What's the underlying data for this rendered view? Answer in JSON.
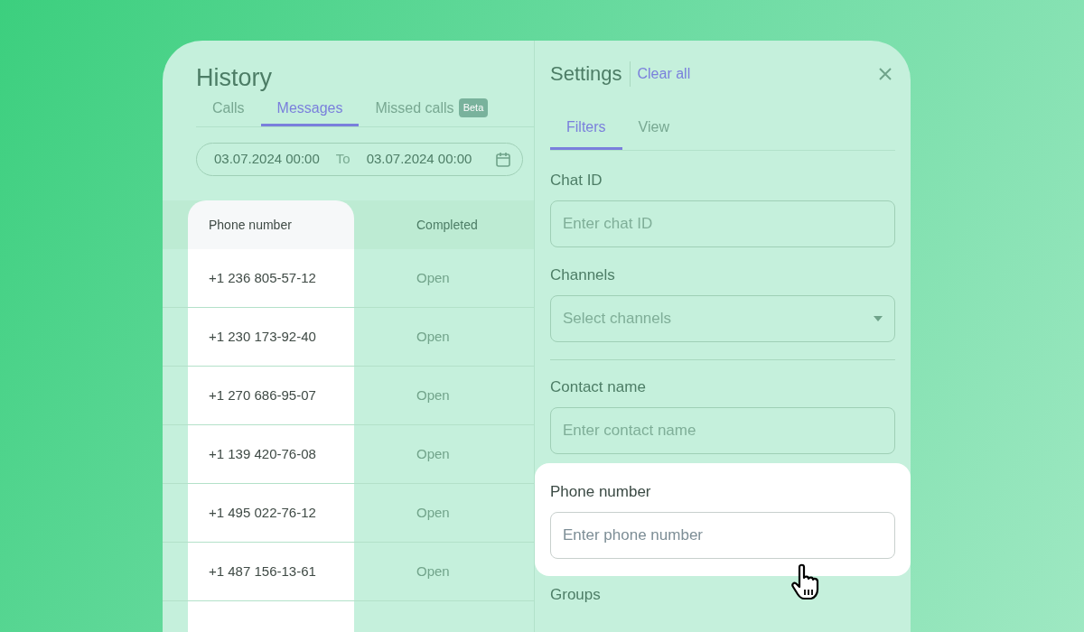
{
  "history": {
    "title": "History",
    "tabs": [
      {
        "label": "Calls",
        "selected": false
      },
      {
        "label": "Messages",
        "selected": true
      },
      {
        "label": "Missed calls",
        "badge": "Beta",
        "selected": false
      }
    ],
    "date_range": {
      "from": "03.07.2024 00:00",
      "separator": "To",
      "to": "03.07.2024 00:00"
    },
    "table": {
      "columns": [
        "Phone number",
        "Completed"
      ],
      "rows": [
        [
          "+1 236 805-57-12",
          "Open"
        ],
        [
          "+1 230 173-92-40",
          "Open"
        ],
        [
          "+1 270 686-95-07",
          "Open"
        ],
        [
          "+1 139 420-76-08",
          "Open"
        ],
        [
          "+1 495 022-76-12",
          "Open"
        ],
        [
          "+1 487 156-13-61",
          "Open"
        ]
      ]
    }
  },
  "settings": {
    "title": "Settings",
    "clear_all": "Clear all",
    "tabs": [
      {
        "label": "Filters",
        "selected": true
      },
      {
        "label": "View",
        "selected": false
      }
    ],
    "fields": [
      {
        "kind": "input",
        "label": "Chat ID",
        "placeholder": "Enter chat ID",
        "highlighted": false
      },
      {
        "kind": "select",
        "label": "Channels",
        "placeholder": "Select channels",
        "highlighted": false
      },
      {
        "kind": "divider"
      },
      {
        "kind": "input",
        "label": "Contact name",
        "placeholder": "Enter contact name",
        "highlighted": false
      },
      {
        "kind": "input",
        "label": "Phone number",
        "placeholder": "Enter phone number",
        "highlighted": true
      },
      {
        "kind": "label",
        "label": "Groups",
        "highlighted": false
      }
    ]
  }
}
